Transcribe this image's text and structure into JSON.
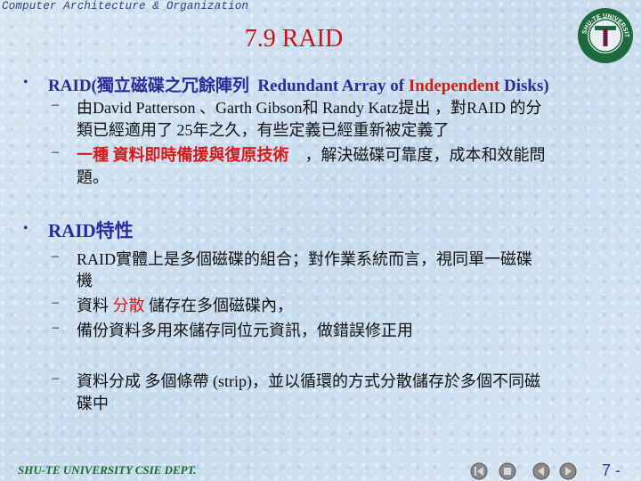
{
  "header": {
    "course_title": "Computer Architecture & Organization",
    "slide_title": "7.9 RAID",
    "logo_text": "SHU-TE UNIVERSITY",
    "logo_letter": "T"
  },
  "bullets": [
    {
      "label_prefix": "RAID(獨立磁碟之冗餘陣列",
      "label_mid": "Redundant Array of ",
      "label_red": "Independent",
      "label_end": " Disks)",
      "subitems": [
        {
          "line1": "由David Patterson 、Garth Gibson和 Randy Katz提出 ，對RAID 的分",
          "line2": "類已經適用了 25年之久，有些定義已經重新被定義了"
        },
        {
          "red": "一種 資料即時備援與復原技術",
          "line1_rest": "，解決磁碟可靠度，成本和效能問",
          "line2": "題。"
        }
      ]
    },
    {
      "label": "RAID特性",
      "subitems": [
        {
          "line1": "RAID實體上是多個磁碟的組合；對作業系統而言，視同單一磁碟",
          "line2": "機"
        },
        {
          "pre": "資料 ",
          "red": "分散",
          "post": " 儲存在多個磁碟內，"
        },
        {
          "line1": "備份資料多用來儲存同位元資訊，做錯誤修正用"
        },
        {
          "line1": "資料分成 多個條帶 (strip)，並以循環的方式分散儲存於多個不同磁",
          "line2": "碟中"
        }
      ]
    }
  ],
  "footer": {
    "dept": "SHU-TE UNIVERSITY  CSIE DEPT.",
    "page": "7 -",
    "nav_icons": [
      "first-slide-icon",
      "stop-icon",
      "previous-slide-icon",
      "next-slide-icon"
    ]
  },
  "colors": {
    "title_red": "#cc1111",
    "bullet_blue": "#2a2a99",
    "highlight_red": "#d81818",
    "footer_green": "#1a6a2a",
    "logo_green": "#1d6b3c"
  }
}
